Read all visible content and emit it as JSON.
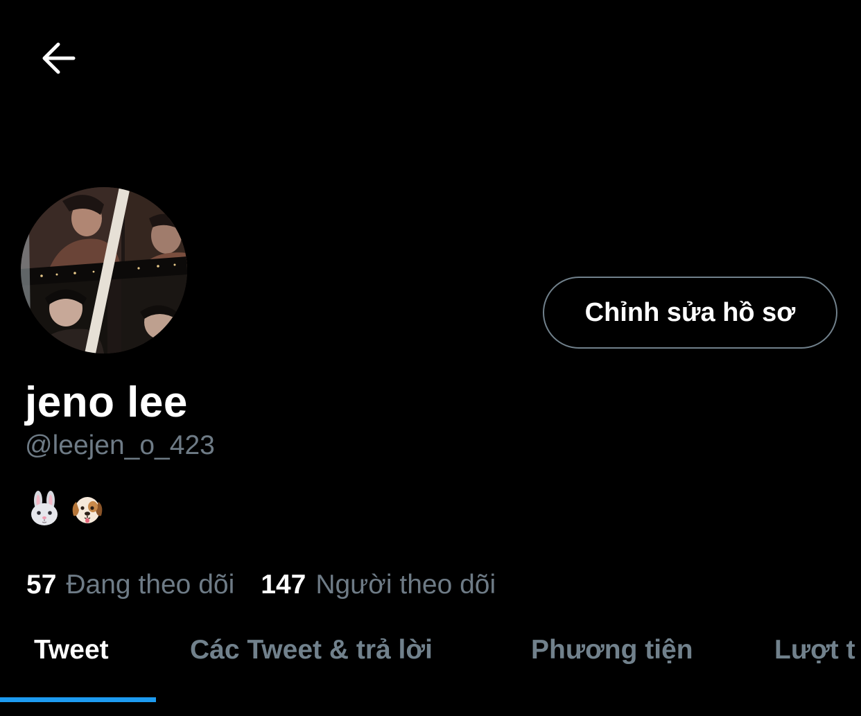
{
  "header": {
    "back_icon": "arrow-left-icon"
  },
  "profile": {
    "avatar_icon": "profile-photo",
    "edit_button_label": "Chỉnh sửa hồ sơ",
    "display_name": "jeno lee",
    "handle": "@leejen_o_423",
    "bio_emojis": [
      "rabbit-face-emoji",
      "dog-face-emoji"
    ]
  },
  "stats": {
    "following_count": "57",
    "following_label": "Đang theo dõi",
    "followers_count": "147",
    "followers_label": "Người theo dõi"
  },
  "tabs": [
    {
      "label": "Tweet",
      "active": true
    },
    {
      "label": "Các Tweet & trả lời",
      "active": false
    },
    {
      "label": "Phương tiện",
      "active": false
    },
    {
      "label": "Lượt t",
      "active": false
    }
  ],
  "colors": {
    "background": "#000000",
    "text_primary": "#ffffff",
    "text_secondary": "#6e7b86",
    "button_border": "#71818c",
    "accent": "#1d9bf0"
  }
}
